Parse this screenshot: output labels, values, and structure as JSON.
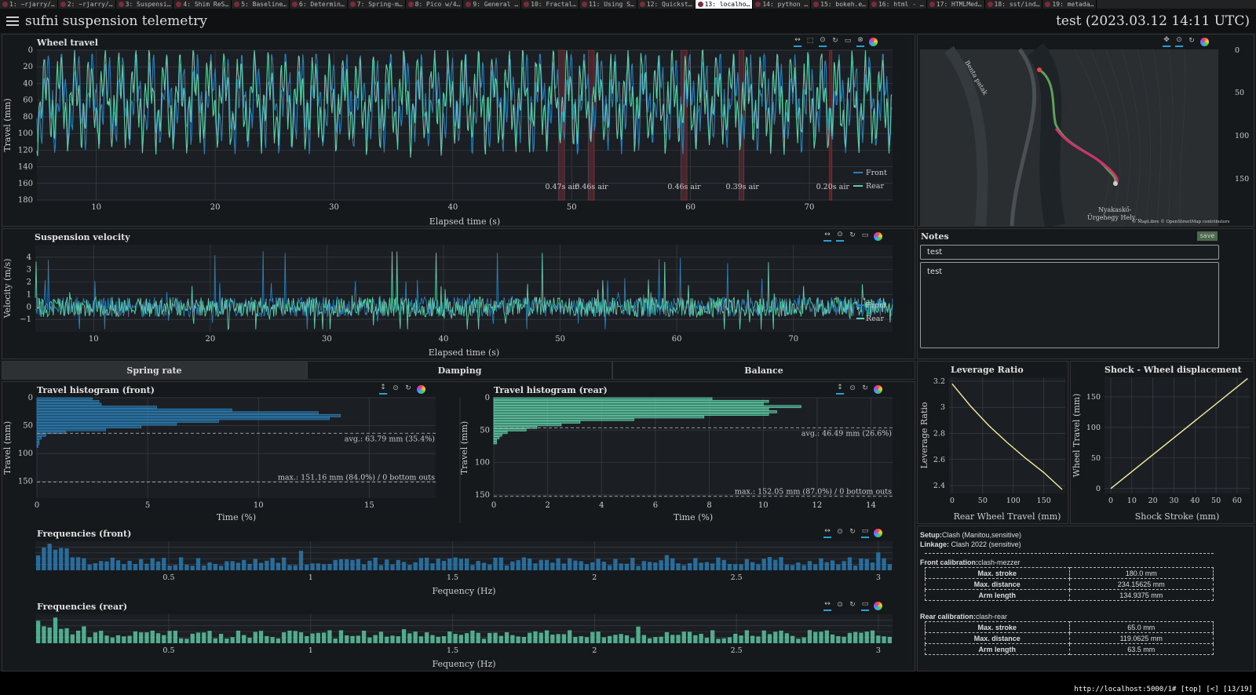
{
  "browser_tabs": [
    "1: ~rjarry/…",
    "2: ~rjarry/…",
    "3: Suspensi…",
    "4: Shim ReS…",
    "5: Baseline…",
    "6: Determin…",
    "7: Spring-m…",
    "8: Pico w/4…",
    "9: General …",
    "10: Fractal…",
    "11: Using S…",
    "12: Quickst…",
    "13: localho…",
    "14: python …",
    "15: bokeh.e…",
    "16: html - …",
    "17: HTMLMed…",
    "18: sst/ind…",
    "19: metada…"
  ],
  "active_tab_index": 12,
  "header": {
    "app_title": "sufni suspension telemetry",
    "session_title": "test (2023.03.12 14:11 UTC)"
  },
  "colors": {
    "front": "#2b7fb8",
    "rear": "#5fcfa8",
    "bg": "#15191c",
    "grid": "#3a3f44",
    "airtime": "#5a2a33"
  },
  "toolbar_icons": [
    "pan-icon",
    "box-zoom-icon",
    "wheel-zoom-icon",
    "reset-icon",
    "hover-icon",
    "bokeh-logo-icon"
  ],
  "wheel_travel": {
    "title": "Wheel travel",
    "chart_data": {
      "type": "line",
      "xlabel": "Elapsed time (s)",
      "ylabel": "Travel (mm)",
      "xlim": [
        5,
        77
      ],
      "ylim": [
        180,
        0
      ],
      "x_ticks": [
        "10",
        "20",
        "30",
        "40",
        "50",
        "60",
        "70"
      ],
      "y_ticks": [
        "0",
        "20",
        "40",
        "60",
        "80",
        "100",
        "120",
        "140",
        "160",
        "180"
      ],
      "legend": [
        "Front",
        "Rear"
      ],
      "legend_position": "bottom-right",
      "airtimes": [
        {
          "start": 48.9,
          "end": 49.4,
          "label": "0.47s air"
        },
        {
          "start": 51.4,
          "end": 51.9,
          "label": "0.46s air"
        },
        {
          "start": 59.2,
          "end": 59.7,
          "label": "0.46s air"
        },
        {
          "start": 64.1,
          "end": 64.5,
          "label": "0.39s air"
        },
        {
          "start": 71.7,
          "end": 71.9,
          "label": "0.20s air"
        }
      ]
    }
  },
  "map": {
    "right_axis_ticks": [
      "0",
      "50",
      "100",
      "150"
    ],
    "labels": [
      "Benta patak",
      "Nyakaskő-",
      "Ürgehegy Hely…",
      "© MapLibre © OpenStreetMap contributors"
    ]
  },
  "velocity": {
    "title": "Suspension velocity",
    "chart_data": {
      "type": "line",
      "xlabel": "Elapsed time (s)",
      "ylabel": "Velocity (m/s)",
      "xlim": [
        5,
        78.5
      ],
      "ylim": [
        -2,
        5
      ],
      "x_ticks": [
        "10",
        "20",
        "30",
        "40",
        "50",
        "60",
        "70"
      ],
      "y_ticks": [
        "4",
        "3",
        "2",
        "1",
        "0",
        "−1"
      ],
      "legend": [
        "Front",
        "Rear"
      ]
    }
  },
  "notes": {
    "title": "Notes",
    "save_label": "save",
    "name_value": "test",
    "description_value": "test"
  },
  "analysis_tabs": [
    "Spring rate",
    "Damping",
    "Balance"
  ],
  "hist_front": {
    "title": "Travel histogram (front)",
    "chart_data": {
      "type": "bar",
      "orientation": "horizontal",
      "xlabel": "Time (%)",
      "ylabel": "Travel (mm)",
      "x_ticks": [
        "0",
        "5",
        "10",
        "15"
      ],
      "y_ticks": [
        "0",
        "50",
        "100",
        "150"
      ],
      "xlim": [
        0,
        18
      ],
      "ylim": [
        0,
        180
      ],
      "bins_start": 0,
      "bin_width": 5,
      "values": [
        2.5,
        2.8,
        2.9,
        5.4,
        8.8,
        12.7,
        13.7,
        13.2,
        8.2,
        6.3,
        4.7,
        3.1,
        1.3,
        0.4,
        0.2,
        0.1,
        0.1,
        0.05
      ],
      "avg_line": 63.79,
      "avg_label": "avg.: 63.79 mm (35.4%)",
      "max_line": 151.16,
      "max_label": "max.: 151.16 mm (84.0%) / 0 bottom outs"
    }
  },
  "hist_rear": {
    "title": "Travel histogram (rear)",
    "chart_data": {
      "type": "bar",
      "orientation": "horizontal",
      "xlabel": "Time (%)",
      "ylabel": "Travel (mm)",
      "x_ticks": [
        "0",
        "2",
        "4",
        "6",
        "8",
        "10",
        "12",
        "14"
      ],
      "y_ticks": [
        "0",
        "50",
        "100",
        "150"
      ],
      "xlim": [
        0,
        14.8
      ],
      "ylim": [
        0,
        155
      ],
      "bins_start": 0,
      "bin_width": 4,
      "values": [
        8.1,
        10.2,
        10.0,
        11.4,
        10.2,
        10.5,
        10.2,
        7.8,
        5.2,
        3.2,
        2.5,
        1.6,
        1.2,
        0.5,
        0.3,
        0.2,
        0.1,
        0.1
      ],
      "avg_line": 46.49,
      "avg_label": "avg.: 46.49 mm (26.6%)",
      "max_line": 152.05,
      "max_label": "max.: 152.05 mm (87.0%) / 0 bottom outs"
    }
  },
  "leverage": {
    "title": "Leverage Ratio",
    "chart_data": {
      "type": "line",
      "xlabel": "Rear Wheel Travel (mm)",
      "ylabel": "Leverage Ratio",
      "xlim": [
        -5,
        185
      ],
      "ylim": [
        2.34,
        3.23
      ],
      "x_ticks": [
        "0",
        "50",
        "100",
        "150"
      ],
      "y_ticks": [
        "3.2",
        "3",
        "2.8",
        "2.6",
        "2.4"
      ],
      "x": [
        0,
        30,
        60,
        90,
        120,
        150,
        180
      ],
      "y": [
        3.18,
        3.01,
        2.86,
        2.73,
        2.61,
        2.5,
        2.37
      ]
    }
  },
  "shock_wheel": {
    "title": "Shock - Wheel displacement",
    "chart_data": {
      "type": "line",
      "xlabel": "Shock Stroke (mm)",
      "ylabel": "Wheel Travel (mm)",
      "xlim": [
        -3,
        66
      ],
      "ylim": [
        -8,
        182
      ],
      "x_ticks": [
        "0",
        "10",
        "20",
        "30",
        "40",
        "50",
        "60"
      ],
      "y_ticks": [
        "150",
        "100",
        "50",
        "0"
      ],
      "x": [
        0,
        65
      ],
      "y": [
        0,
        180
      ]
    }
  },
  "freq_front": {
    "title": "Frequencies (front)",
    "chart_data": {
      "type": "bar",
      "xlabel": "Fequency (Hz)",
      "x_ticks": [
        "0.5",
        "1",
        "1.5",
        "2",
        "2.5",
        "3"
      ],
      "xlim": [
        0.03,
        3.05
      ],
      "bar_count": 150
    }
  },
  "freq_rear": {
    "title": "Frequencies (rear)",
    "chart_data": {
      "type": "bar",
      "xlabel": "Fequency (Hz)",
      "x_ticks": [
        "0.5",
        "1",
        "1.5",
        "2",
        "2.5",
        "3"
      ],
      "xlim": [
        0.03,
        3.05
      ],
      "bar_count": 150
    }
  },
  "setup": {
    "setup_label": "Setup:",
    "setup_value": "Clash (Manitou,sensitive)",
    "linkage_label": "Linkage:",
    "linkage_value": "Clash 2022 (sensitive)",
    "front_label": "Front calibration:",
    "front_value": "clash-mezzer",
    "front_rows": [
      {
        "k": "Max. stroke",
        "v": "180.0 mm"
      },
      {
        "k": "Max. distance",
        "v": "234.15625 mm"
      },
      {
        "k": "Arm length",
        "v": "134.9375 mm"
      }
    ],
    "rear_label": "Rear calibration:",
    "rear_value": "clash-rear",
    "rear_rows": [
      {
        "k": "Max. stroke",
        "v": "65.0 mm"
      },
      {
        "k": "Max. distance",
        "v": "119.0625 mm"
      },
      {
        "k": "Arm length",
        "v": "63.5 mm"
      }
    ]
  },
  "status": {
    "url": "http://localhost:5000/1# [top] [<] [13/19]"
  }
}
